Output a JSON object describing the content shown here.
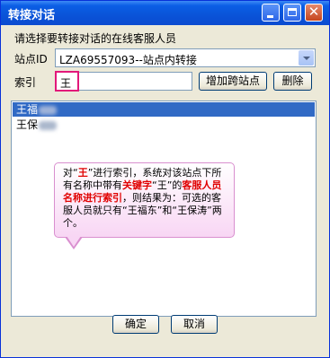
{
  "window": {
    "title": "转接对话"
  },
  "titlebar_buttons": {
    "minimize": "minimize-icon",
    "maximize": "maximize-icon",
    "close": "close-icon"
  },
  "form": {
    "instruction": "请选择要转接对话的在线客服人员",
    "site_label": "站点ID",
    "site_value": "LZA69557093--站点内转接",
    "index_label": "索引",
    "index_value": "王",
    "add_site_button": "增加跨站点",
    "delete_button": "删除"
  },
  "list": {
    "items": [
      {
        "label": "王福",
        "selected": true
      },
      {
        "label": "王保",
        "selected": false
      }
    ]
  },
  "callout": {
    "p1": "对“",
    "p2": "王",
    "p3": "”进行索引，系统对该站点下所有名称中带有",
    "p4": "关键字",
    "p5": "“王”的",
    "p6": "客服人员名称进行索引",
    "p7": "，则结果为：可选的客服人员就只有“王福东”和“王保涛”两个。"
  },
  "footer": {
    "ok_button": "确定",
    "cancel_button": "取消"
  },
  "colors": {
    "title_bar": "#0b5ee5",
    "selection": "#316ac5",
    "highlight_border": "#e2187a",
    "callout_emphasis": "#e00000"
  }
}
